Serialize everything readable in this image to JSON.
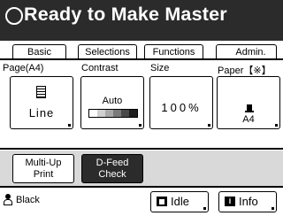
{
  "header": {
    "title": "Ready to Make Master"
  },
  "tabs": [
    {
      "label": "Basic"
    },
    {
      "label": "Selections"
    },
    {
      "label": "Functions"
    },
    {
      "label": "Admin."
    }
  ],
  "settings": {
    "page": {
      "label": "Page(A4)",
      "value": "Line",
      "icon": "page-icon"
    },
    "contrast": {
      "label": "Contrast",
      "value": "Auto",
      "colors": [
        "#ffffff",
        "#d0d0d0",
        "#a8a8a8",
        "#7a7a7a",
        "#4a4a4a",
        "#1e1e1e"
      ]
    },
    "size": {
      "label": "Size",
      "value": "100%"
    },
    "paper": {
      "label": "Paper【※】",
      "value": "A4",
      "icon": "paper-icon"
    }
  },
  "actions": {
    "multi_up": {
      "line1": "Multi-Up",
      "line2": "Print"
    },
    "dfeed": {
      "line1": "D-Feed",
      "line2": "Check"
    }
  },
  "footer": {
    "user": "Black",
    "idle": "Idle",
    "info": "Info",
    "info_icon": "i"
  }
}
